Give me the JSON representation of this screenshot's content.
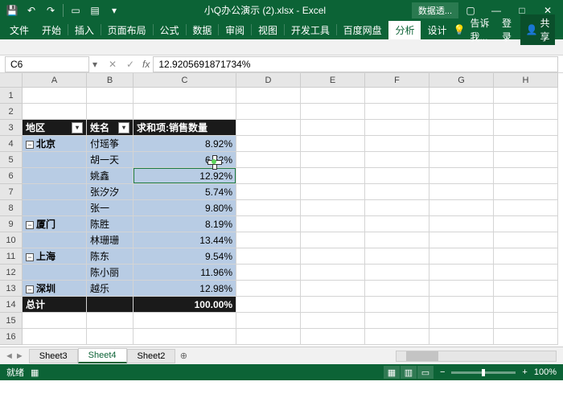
{
  "titlebar": {
    "filename": "小Q办公演示 (2).xlsx - Excel",
    "context_tab": "数据透..."
  },
  "win": {
    "min": "—",
    "max": "□",
    "close": "✕",
    "ribmin": "▢"
  },
  "ribbon": {
    "file": "文件",
    "tabs": [
      "开始",
      "插入",
      "页面布局",
      "公式",
      "数据",
      "审阅",
      "视图",
      "开发工具",
      "百度网盘"
    ],
    "ctx": [
      "分析",
      "设计"
    ],
    "tell": "告诉我...",
    "login": "登录",
    "share": "共享"
  },
  "namebox": {
    "ref": "C6"
  },
  "formula": {
    "value": "12.9205691871734%"
  },
  "cols": [
    "A",
    "B",
    "C",
    "D",
    "E",
    "F",
    "G",
    "H"
  ],
  "rows_n": 16,
  "pivot": {
    "headers": {
      "region": "地区",
      "name": "姓名",
      "sum": "求和项:销售数量"
    },
    "rows": [
      {
        "region": "北京",
        "name": "付瑶筝",
        "val": "8.92%",
        "first": true
      },
      {
        "region": "",
        "name": "胡一天",
        "val": "6.52%"
      },
      {
        "region": "",
        "name": "姚鑫",
        "val": "12.92%"
      },
      {
        "region": "",
        "name": "张汐汐",
        "val": "5.74%"
      },
      {
        "region": "",
        "name": "张一",
        "val": "9.80%"
      },
      {
        "region": "厦门",
        "name": "陈胜",
        "val": "8.19%",
        "first": true
      },
      {
        "region": "",
        "name": "林珊珊",
        "val": "13.44%"
      },
      {
        "region": "上海",
        "name": "陈东",
        "val": "9.54%",
        "first": true
      },
      {
        "region": "",
        "name": "陈小丽",
        "val": "11.96%"
      },
      {
        "region": "深圳",
        "name": "越乐",
        "val": "12.98%",
        "first": true
      }
    ],
    "total": {
      "label": "总计",
      "val": "100.00%"
    }
  },
  "sheets": {
    "nav": [
      "◄",
      "►"
    ],
    "tabs": [
      "Sheet3",
      "Sheet4",
      "Sheet2"
    ],
    "active": 1,
    "add": "⊕"
  },
  "status": {
    "ready": "就绪",
    "zoom": "100%",
    "plus": "+",
    "minus": "−"
  }
}
